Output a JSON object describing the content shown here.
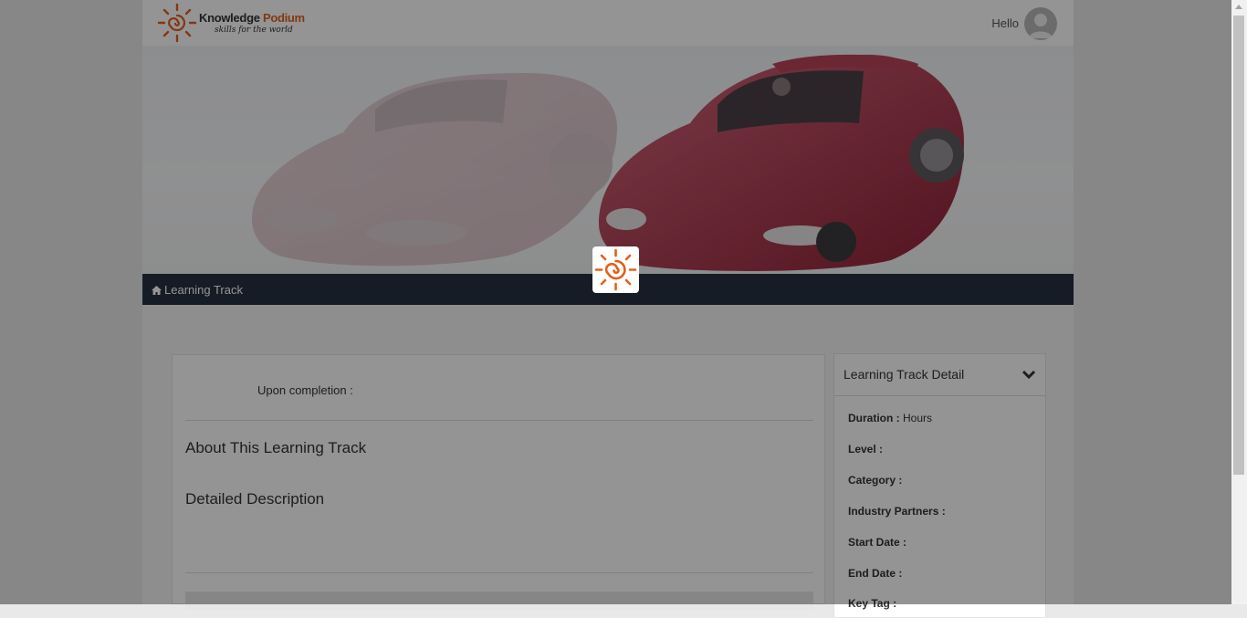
{
  "header": {
    "logo": {
      "name_part1": "Knowledge ",
      "name_part2": "Podium",
      "tagline": "skills for the world"
    },
    "greeting": "Hello",
    "avatar_icon": "user-avatar-icon"
  },
  "breadcrumb": {
    "icon": "home-icon",
    "label": "Learning Track"
  },
  "main": {
    "upon_completion_label": "Upon completion :",
    "about_heading": "About This Learning Track",
    "detailed_heading": "Detailed Description"
  },
  "sidebar": {
    "title": "Learning Track Detail",
    "toggle_icon": "chevron-down-icon",
    "fields": [
      {
        "label": "Duration :",
        "value": "Hours"
      },
      {
        "label": "Level :",
        "value": ""
      },
      {
        "label": "Category :",
        "value": ""
      },
      {
        "label": "Industry Partners :",
        "value": ""
      },
      {
        "label": "Start Date :",
        "value": ""
      },
      {
        "label": "End Date :",
        "value": ""
      },
      {
        "label": "Key Tag :",
        "value": ""
      }
    ]
  },
  "colors": {
    "brand_orange": "#e2601d",
    "nav_dark": "#253142",
    "overlay": "rgba(0,0,0,0.42)"
  }
}
